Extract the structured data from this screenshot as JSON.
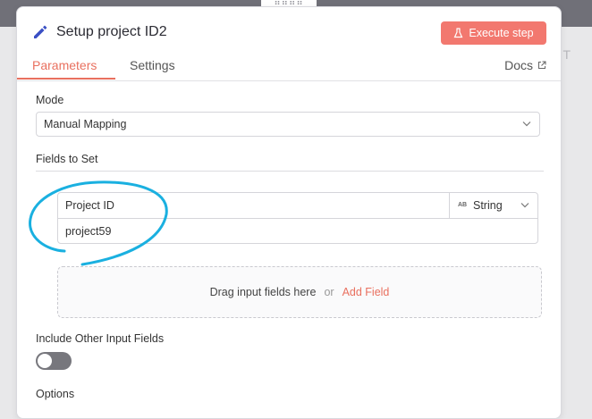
{
  "background": {
    "handle_glyph": "⠿⠿⠿⠿",
    "output_label": "UT"
  },
  "node": {
    "title": "Setup project ID2",
    "execute_label": "Execute step"
  },
  "tabs": {
    "parameters": "Parameters",
    "settings": "Settings",
    "docs": "Docs"
  },
  "mode": {
    "label": "Mode",
    "value": "Manual Mapping"
  },
  "fields_to_set": {
    "label": "Fields to Set",
    "fields": [
      {
        "name": "Project ID",
        "type_badge": "AB",
        "type": "String",
        "value": "project59"
      }
    ]
  },
  "dropzone": {
    "text": "Drag input fields here",
    "or_text": "or",
    "add_field": "Add Field"
  },
  "include_other": {
    "label": "Include Other Input Fields",
    "enabled": false
  },
  "options": {
    "label": "Options"
  },
  "colors": {
    "accent": "#e9705f",
    "execute_bg": "#f2786f",
    "annotation": "#1ab0e0",
    "toggle_off": "#77777d"
  },
  "icons": [
    "pencil-icon",
    "flask-icon",
    "external-link-icon",
    "chevron-down-icon",
    "drag-handle-icon"
  ]
}
